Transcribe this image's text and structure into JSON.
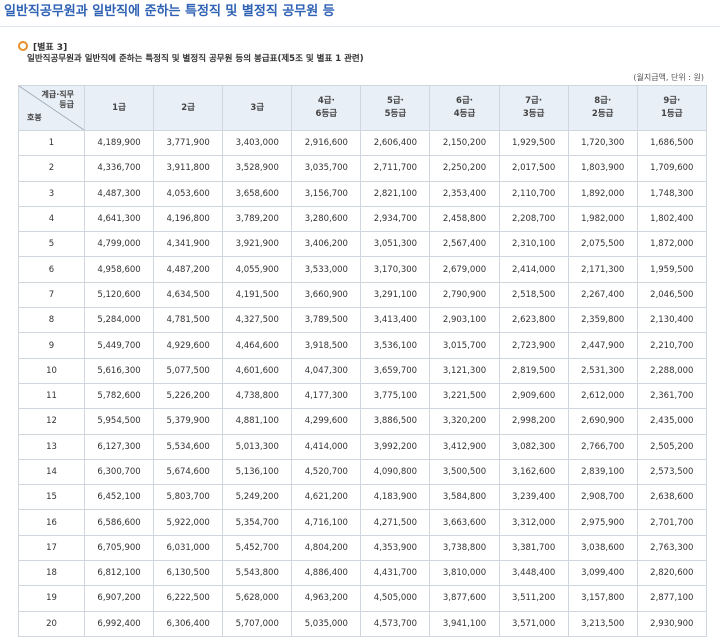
{
  "page_title": "일반직공무원과 일반직에 준하는 특정직 및 별정직 공무원 등",
  "section_tag": "[별표 3]",
  "subtitle": "일반직공무원과 일반직에 준하는 특정직 및 별정직 공무원 등의 봉급표(제5조 및 별표 1 관련)",
  "unit_note": "(월지급액, 단위 : 원)",
  "corner": {
    "top_line1": "계급·직무",
    "top_line2": "등급",
    "bottom": "호봉"
  },
  "columns": [
    [
      "1급"
    ],
    [
      "2급"
    ],
    [
      "3급"
    ],
    [
      "4급·",
      "6등급"
    ],
    [
      "5급·",
      "5등급"
    ],
    [
      "6급·",
      "4등급"
    ],
    [
      "7급·",
      "3등급"
    ],
    [
      "8급·",
      "2등급"
    ],
    [
      "9급·",
      "1등급"
    ]
  ],
  "rows": [
    [
      "1",
      "4,189,900",
      "3,771,900",
      "3,403,000",
      "2,916,600",
      "2,606,400",
      "2,150,200",
      "1,929,500",
      "1,720,300",
      "1,686,500"
    ],
    [
      "2",
      "4,336,700",
      "3,911,800",
      "3,528,900",
      "3,035,700",
      "2,711,700",
      "2,250,200",
      "2,017,500",
      "1,803,900",
      "1,709,600"
    ],
    [
      "3",
      "4,487,300",
      "4,053,600",
      "3,658,600",
      "3,156,700",
      "2,821,100",
      "2,353,400",
      "2,110,700",
      "1,892,000",
      "1,748,300"
    ],
    [
      "4",
      "4,641,300",
      "4,196,800",
      "3,789,200",
      "3,280,600",
      "2,934,700",
      "2,458,800",
      "2,208,700",
      "1,982,000",
      "1,802,400"
    ],
    [
      "5",
      "4,799,000",
      "4,341,900",
      "3,921,900",
      "3,406,200",
      "3,051,300",
      "2,567,400",
      "2,310,100",
      "2,075,500",
      "1,872,000"
    ],
    [
      "6",
      "4,958,600",
      "4,487,200",
      "4,055,900",
      "3,533,000",
      "3,170,300",
      "2,679,000",
      "2,414,000",
      "2,171,300",
      "1,959,500"
    ],
    [
      "7",
      "5,120,600",
      "4,634,500",
      "4,191,500",
      "3,660,900",
      "3,291,100",
      "2,790,900",
      "2,518,500",
      "2,267,400",
      "2,046,500"
    ],
    [
      "8",
      "5,284,000",
      "4,781,500",
      "4,327,500",
      "3,789,500",
      "3,413,400",
      "2,903,100",
      "2,623,800",
      "2,359,800",
      "2,130,400"
    ],
    [
      "9",
      "5,449,700",
      "4,929,600",
      "4,464,600",
      "3,918,500",
      "3,536,100",
      "3,015,700",
      "2,723,900",
      "2,447,900",
      "2,210,700"
    ],
    [
      "10",
      "5,616,300",
      "5,077,500",
      "4,601,600",
      "4,047,300",
      "3,659,700",
      "3,121,300",
      "2,819,500",
      "2,531,300",
      "2,288,000"
    ],
    [
      "11",
      "5,782,600",
      "5,226,200",
      "4,738,800",
      "4,177,300",
      "3,775,100",
      "3,221,500",
      "2,909,600",
      "2,612,000",
      "2,361,700"
    ],
    [
      "12",
      "5,954,500",
      "5,379,900",
      "4,881,100",
      "4,299,600",
      "3,886,500",
      "3,320,200",
      "2,998,200",
      "2,690,900",
      "2,435,000"
    ],
    [
      "13",
      "6,127,300",
      "5,534,600",
      "5,013,300",
      "4,414,000",
      "3,992,200",
      "3,412,900",
      "3,082,300",
      "2,766,700",
      "2,505,200"
    ],
    [
      "14",
      "6,300,700",
      "5,674,600",
      "5,136,100",
      "4,520,700",
      "4,090,800",
      "3,500,500",
      "3,162,600",
      "2,839,100",
      "2,573,500"
    ],
    [
      "15",
      "6,452,100",
      "5,803,700",
      "5,249,200",
      "4,621,200",
      "4,183,900",
      "3,584,800",
      "3,239,400",
      "2,908,700",
      "2,638,600"
    ],
    [
      "16",
      "6,586,600",
      "5,922,000",
      "5,354,700",
      "4,716,100",
      "4,271,500",
      "3,663,600",
      "3,312,000",
      "2,975,900",
      "2,701,700"
    ],
    [
      "17",
      "6,705,900",
      "6,031,000",
      "5,452,700",
      "4,804,200",
      "4,353,900",
      "3,738,800",
      "3,381,700",
      "3,038,600",
      "2,763,300"
    ],
    [
      "18",
      "6,812,100",
      "6,130,500",
      "5,543,800",
      "4,886,400",
      "4,431,700",
      "3,810,000",
      "3,448,400",
      "3,099,400",
      "2,820,600"
    ],
    [
      "19",
      "6,907,200",
      "6,222,500",
      "5,628,000",
      "4,963,200",
      "4,505,000",
      "3,877,600",
      "3,511,200",
      "3,157,800",
      "2,877,100"
    ],
    [
      "20",
      "6,992,400",
      "6,306,400",
      "5,707,000",
      "5,035,000",
      "4,573,700",
      "3,941,100",
      "3,571,000",
      "3,213,500",
      "2,930,900"
    ]
  ]
}
